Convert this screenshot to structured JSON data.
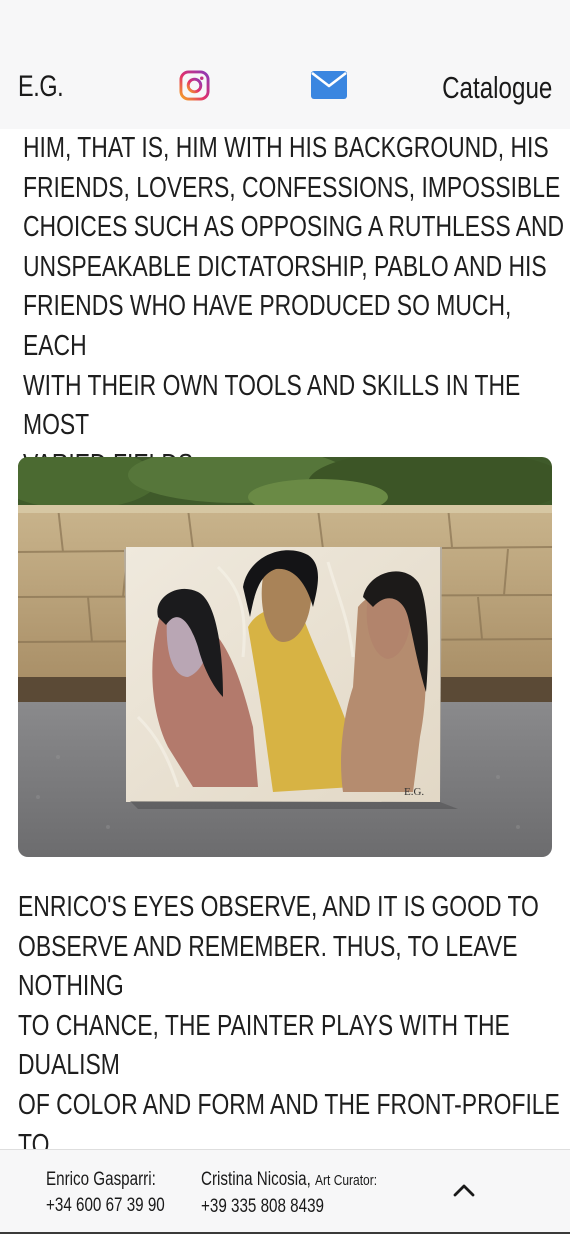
{
  "header": {
    "brand": "E.G.",
    "instagram_icon": "instagram-icon",
    "mail_icon": "envelope-icon",
    "nav_catalogue": "Catalogue"
  },
  "content": {
    "paragraph_1": "HIM, THAT IS, HIM WITH HIS BACKGROUND, HIS\nFRIENDS, LOVERS, CONFESSIONS, IMPOSSIBLE\nCHOICES SUCH AS OPPOSING A RUTHLESS AND\nUNSPEAKABLE DICTATORSHIP, PABLO AND HIS\nFRIENDS WHO HAVE PRODUCED SO MUCH, EACH\nWITH THEIR OWN TOOLS AND SKILLS IN THE MOST\nVARIED FIELDS.",
    "artwork_signature": "E.G.",
    "paragraph_2": "ENRICO'S EYES OBSERVE, AND IT IS GOOD TO\nOBSERVE AND REMEMBER. THUS, TO LEAVE NOTHING\nTO CHANCE, THE PAINTER PLAYS WITH THE DUALISM\nOF COLOR AND FORM AND THE FRONT-PROFILE TO\nGIVE US IN THIS NEW CENTURY A DOUBLE AND NON-\nMONOTONOUS VISION OF THINGS AND REALITY."
  },
  "footer": {
    "contact_1_name": "Enrico Gasparri:",
    "contact_1_phone": "+34 600 67 39 90",
    "contact_2_name": "Cristina Nicosia,",
    "contact_2_role": "Art Curator:",
    "contact_2_phone": "+39 335 808 8439",
    "scroll_top_icon": "chevron-up-icon"
  },
  "colors": {
    "header_bg": "#f7f7f8",
    "mail_blue": "#3a86e0",
    "text": "#1e1e1e"
  }
}
